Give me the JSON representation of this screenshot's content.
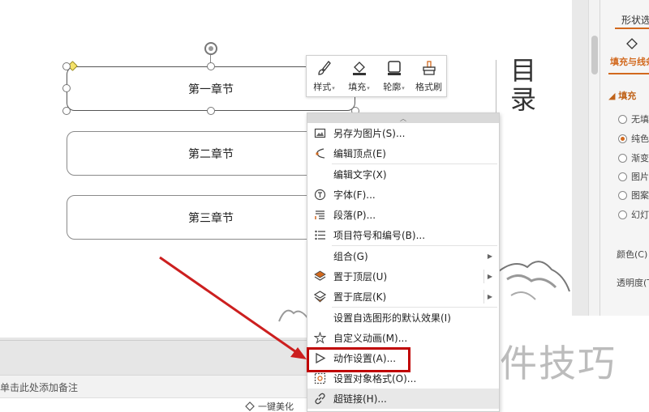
{
  "slide": {
    "shapes": [
      "第一章节",
      "第二章节",
      "第三章节"
    ],
    "toc_title": "目录"
  },
  "mini_toolbar": {
    "buttons": [
      {
        "label": "样式",
        "icon": "brush-icon",
        "has_dropdown": true
      },
      {
        "label": "填充",
        "icon": "fill-bucket-icon",
        "has_dropdown": true
      },
      {
        "label": "轮廓",
        "icon": "outline-icon",
        "has_dropdown": true
      },
      {
        "label": "格式刷",
        "icon": "format-painter-icon",
        "has_dropdown": false
      }
    ]
  },
  "context_menu": {
    "items": [
      {
        "label": "另存为图片(S)...",
        "icon": "image-icon"
      },
      {
        "label": "编辑顶点(E)",
        "icon": "edit-points-icon"
      },
      {
        "label": "编辑文字(X)",
        "icon": ""
      },
      {
        "label": "字体(F)...",
        "icon": "font-icon"
      },
      {
        "label": "段落(P)...",
        "icon": "paragraph-icon"
      },
      {
        "label": "项目符号和编号(B)...",
        "icon": "bullet-list-icon"
      },
      {
        "label": "组合(G)",
        "icon": "",
        "submenu": true
      },
      {
        "label": "置于顶层(U)",
        "icon": "bring-to-front-icon",
        "submenu": true
      },
      {
        "label": "置于底层(K)",
        "icon": "send-to-back-icon",
        "submenu": true
      },
      {
        "label": "设置自选图形的默认效果(I)",
        "icon": ""
      },
      {
        "label": "自定义动画(M)...",
        "icon": "star-animation-icon"
      },
      {
        "label": "动作设置(A)...",
        "icon": "play-action-icon"
      },
      {
        "label": "设置对象格式(O)...",
        "icon": "format-object-icon"
      },
      {
        "label": "超链接(H)...",
        "icon": "link-icon"
      }
    ]
  },
  "notes_bar": {
    "placeholder": "单击此处添加备注"
  },
  "status_bar": {
    "beautify_label": "一键美化"
  },
  "right_panel": {
    "tab": "形状选项",
    "sub_tab": "填充与线条",
    "section": "填充",
    "fill_options": [
      "无填充",
      "纯色填充",
      "渐变填充",
      "图片或纹理填充",
      "图案填充",
      "幻灯片背景填充"
    ],
    "selected_option": 1,
    "color_label": "颜色(C)",
    "transparency_label": "透明度(T)"
  },
  "watermark": "软件技巧",
  "colors": {
    "accent": "#d2691e",
    "highlight_red": "#c00000",
    "arrow_red": "#cc1f1f"
  }
}
